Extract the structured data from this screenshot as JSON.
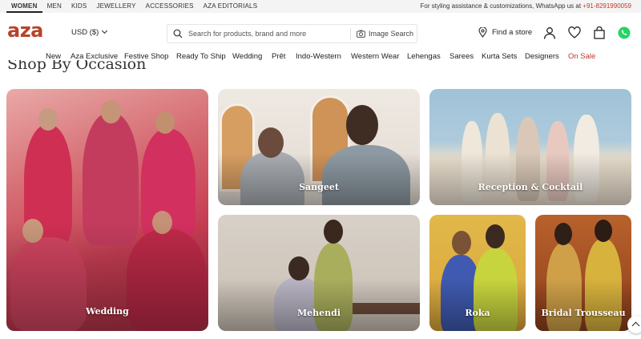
{
  "topbar": {
    "links": [
      "WOMEN",
      "MEN",
      "KIDS",
      "JEWELLERY",
      "ACCESSORIES",
      "AZA EDITORIALS"
    ],
    "assist_text": "For styling assistance & customizations, WhatsApp us at ",
    "assist_phone": "+91-8291990059"
  },
  "header": {
    "logo": "aza",
    "currency": "USD ($)",
    "search_placeholder": "Search for products, brand and more",
    "image_search": "Image Search",
    "find_store": "Find a store"
  },
  "nav": {
    "items": [
      "New",
      "Aza Exclusive",
      "Festive Shop",
      "Ready To Ship",
      "Wedding",
      "Prêt",
      "Indo-Western",
      "Western Wear",
      "Lehengas",
      "Sarees",
      "Kurta Sets",
      "Designers",
      "On Sale"
    ]
  },
  "section": {
    "title": "Shop By Occasion"
  },
  "occasions": [
    {
      "label": "Wedding"
    },
    {
      "label": "Sangeet"
    },
    {
      "label": "Reception & Cocktail"
    },
    {
      "label": "Mehendi"
    },
    {
      "label": "Roka"
    },
    {
      "label": "Bridal Trousseau"
    }
  ],
  "colors": {
    "brand": "#b5432b",
    "sale": "#c0392b",
    "whatsapp": "#25d366"
  },
  "icons": {
    "search": "search-icon",
    "camera": "camera-icon",
    "location": "location-pin-icon",
    "user": "user-icon",
    "wishlist": "heart-icon",
    "bag": "shopping-bag-icon",
    "whatsapp": "whatsapp-icon",
    "scroll_top": "chevron-up-icon"
  }
}
